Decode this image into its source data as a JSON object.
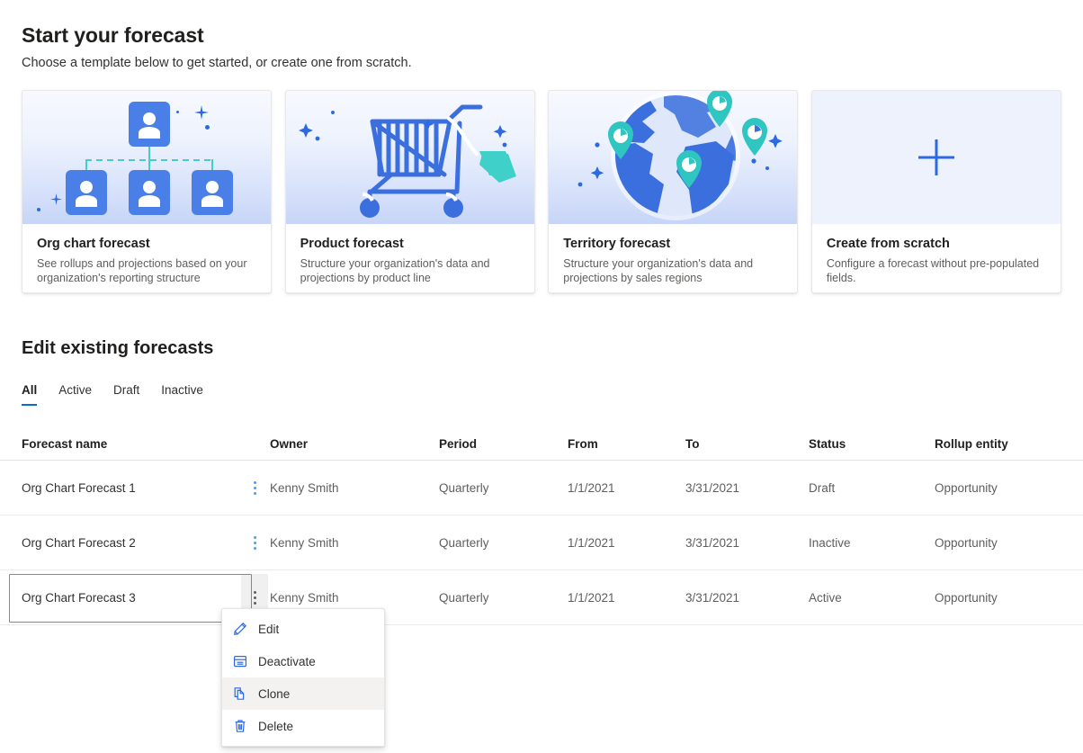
{
  "header": {
    "title": "Start your forecast",
    "subtitle": "Choose a template below to get started, or create one from scratch."
  },
  "templates": [
    {
      "id": "org-chart-forecast",
      "title": "Org chart forecast",
      "description": "See rollups and projections based on your organization's reporting structure",
      "art": "org-chart-illustration"
    },
    {
      "id": "product-forecast",
      "title": "Product forecast",
      "description": "Structure your organization's data and projections by product line",
      "art": "shopping-cart-illustration"
    },
    {
      "id": "territory-forecast",
      "title": "Territory forecast",
      "description": "Structure your organization's data and projections by sales regions",
      "art": "globe-pins-illustration"
    },
    {
      "id": "create-from-scratch",
      "title": "Create from scratch",
      "description": "Configure a forecast without pre-populated fields.",
      "art": "plus-icon"
    }
  ],
  "existing": {
    "section_title": "Edit existing forecasts",
    "tabs": [
      {
        "label": "All",
        "active": true
      },
      {
        "label": "Active",
        "active": false
      },
      {
        "label": "Draft",
        "active": false
      },
      {
        "label": "Inactive",
        "active": false
      }
    ],
    "columns": {
      "name": "Forecast name",
      "owner": "Owner",
      "period": "Period",
      "from": "From",
      "to": "To",
      "status": "Status",
      "rollup": "Rollup entity"
    },
    "rows": [
      {
        "name": "Org Chart Forecast 1",
        "owner": "Kenny Smith",
        "period": "Quarterly",
        "from": "1/1/2021",
        "to": "3/31/2021",
        "status": "Draft",
        "rollup": "Opportunity"
      },
      {
        "name": "Org Chart Forecast 2",
        "owner": "Kenny Smith",
        "period": "Quarterly",
        "from": "1/1/2021",
        "to": "3/31/2021",
        "status": "Inactive",
        "rollup": "Opportunity"
      },
      {
        "name": "Org Chart Forecast 3",
        "owner": "Kenny Smith",
        "period": "Quarterly",
        "from": "1/1/2021",
        "to": "3/31/2021",
        "status": "Active",
        "rollup": "Opportunity"
      }
    ]
  },
  "context_menu": {
    "items": [
      {
        "label": "Edit",
        "icon": "pencil-icon",
        "hovered": false
      },
      {
        "label": "Deactivate",
        "icon": "archive-box-icon",
        "hovered": false
      },
      {
        "label": "Clone",
        "icon": "copy-icon",
        "hovered": true
      },
      {
        "label": "Delete",
        "icon": "trash-icon",
        "hovered": false
      }
    ]
  },
  "colors": {
    "accent": "#0f6cbd",
    "illustration_blue": "#4a7fe8",
    "illustration_teal": "#3fd0c9",
    "text_primary": "#201f1e",
    "text_secondary": "#605e5c",
    "plus_blue": "#2b6ae0"
  }
}
